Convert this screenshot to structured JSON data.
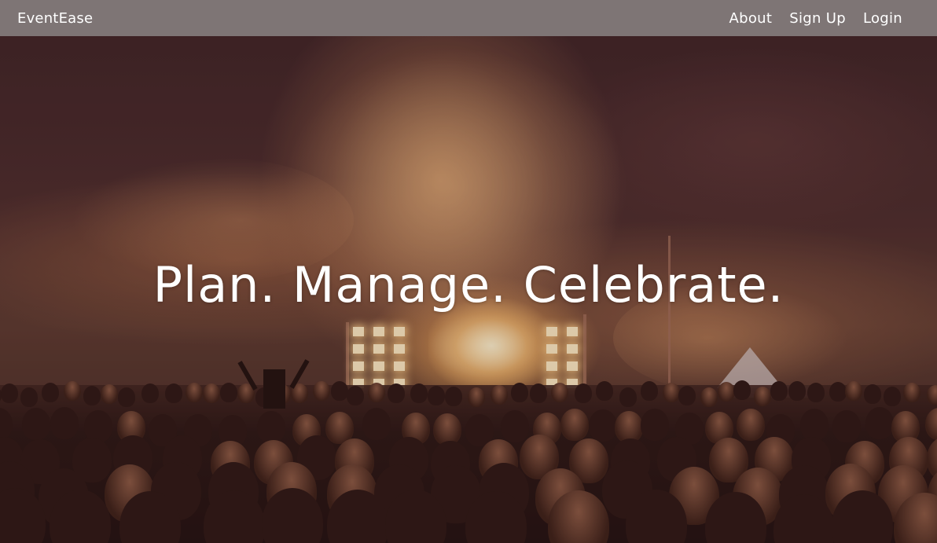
{
  "navbar": {
    "brand": "EventEase",
    "links": [
      {
        "label": "About"
      },
      {
        "label": "Sign Up"
      },
      {
        "label": "Login"
      }
    ]
  },
  "hero": {
    "headline": "Plan. Manage. Celebrate.",
    "background_image": "concert-crowd-stage-lights"
  },
  "colors": {
    "navbar_bg": "#807878",
    "text": "#ffffff",
    "hero_tint": "#4a2c2c"
  }
}
